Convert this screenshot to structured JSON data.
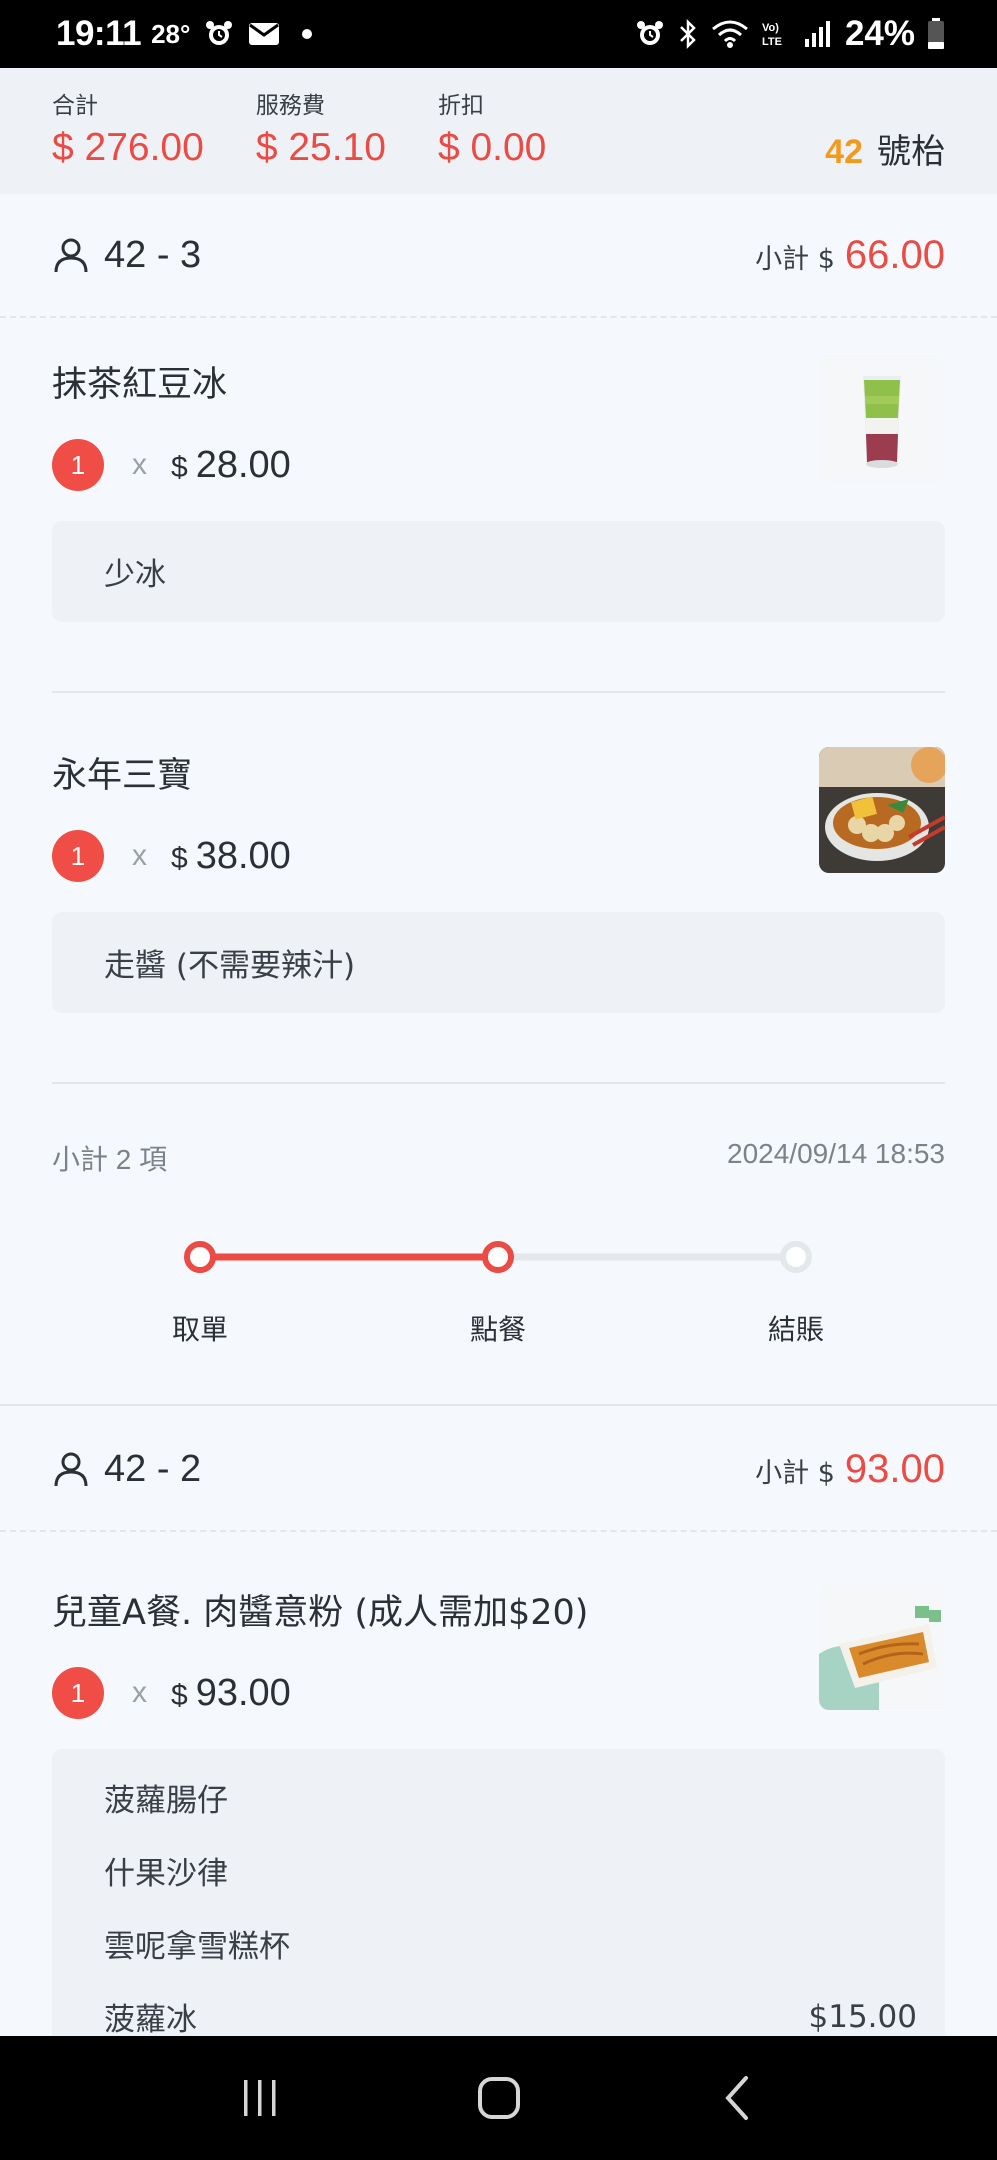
{
  "status_bar": {
    "time": "19:11",
    "temperature": "28°",
    "battery": "24%",
    "volte_label": "Vo) LTE"
  },
  "summary": {
    "total_label": "合計",
    "total_value": "$ 276.00",
    "service_label": "服務費",
    "service_value": "$ 25.10",
    "discount_label": "折扣",
    "discount_value": "$ 0.00",
    "table_number": "42",
    "table_suffix": "號枱"
  },
  "groups": [
    {
      "title": "42 - 3",
      "subtotal_label": "小計 $",
      "subtotal_value": "66.00",
      "items": [
        {
          "name": "抹茶紅豆冰",
          "qty": "1",
          "times": "x",
          "currency": "$",
          "price": "28.00",
          "note": "少冰",
          "image": "green-tea-red-bean-drink"
        },
        {
          "name": "永年三寶",
          "qty": "1",
          "times": "x",
          "currency": "$",
          "price": "38.00",
          "note": "走醬 (不需要辣汁)",
          "image": "fishball-radish-bowl"
        }
      ],
      "item_count": "小計 2 項",
      "timestamp": "2024/09/14 18:53",
      "steps": [
        {
          "label": "取單",
          "state": "done"
        },
        {
          "label": "點餐",
          "state": "current"
        },
        {
          "label": "結賬",
          "state": "pending"
        }
      ]
    },
    {
      "title": "42 - 2",
      "subtotal_label": "小計 $",
      "subtotal_value": "93.00",
      "items": [
        {
          "name": "兒童A餐. 肉醬意粉 (成人需加$20)",
          "qty": "1",
          "times": "x",
          "currency": "$",
          "price": "93.00",
          "image": "kids-meal-spaghetti",
          "options": [
            {
              "label": "菠蘿腸仔",
              "extra": ""
            },
            {
              "label": "什果沙律",
              "extra": ""
            },
            {
              "label": "雲呢拿雪糕杯",
              "extra": ""
            },
            {
              "label": "菠蘿冰",
              "extra": "$15.00"
            }
          ]
        }
      ]
    }
  ],
  "colors": {
    "accent_red": "#ea4b44",
    "table_orange": "#f39a1d",
    "progress_inactive": "#e4e7eb"
  },
  "nav": {
    "recent": "recent-apps-icon",
    "home": "home-icon",
    "back": "back-icon"
  }
}
